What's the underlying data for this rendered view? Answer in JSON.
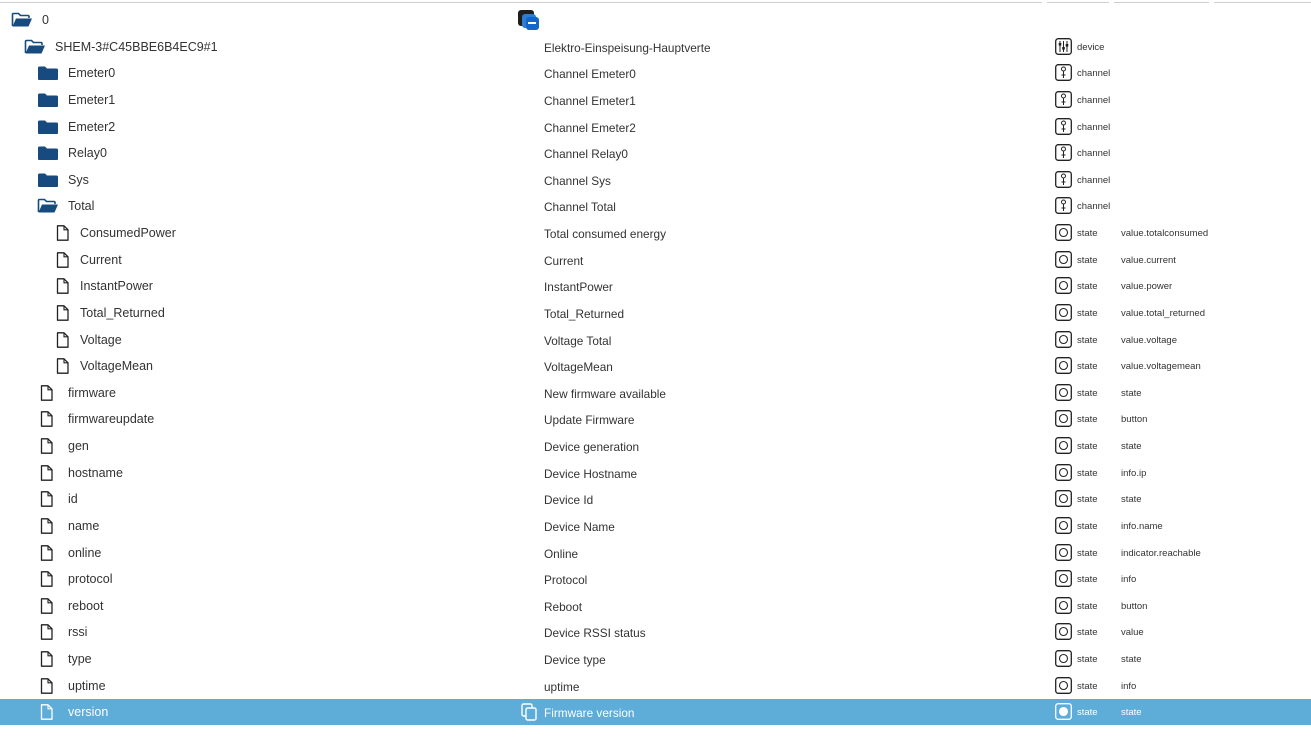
{
  "tree": {
    "rows": [
      {
        "id": "0",
        "name": "",
        "kind": "root",
        "type": "",
        "role": "",
        "indent": 0,
        "icon": "folder-open-icon"
      },
      {
        "id": "SHEM-3#C45BBE6B4EC9#1",
        "name": "Elektro-Einspeisung-Hauptverte",
        "kind": "device",
        "type": "device",
        "role": "",
        "indent": 1,
        "icon": "folder-open-icon"
      },
      {
        "id": "Emeter0",
        "name": "Channel Emeter0",
        "kind": "channel",
        "type": "channel",
        "role": "",
        "indent": 2,
        "icon": "folder-icon"
      },
      {
        "id": "Emeter1",
        "name": "Channel Emeter1",
        "kind": "channel",
        "type": "channel",
        "role": "",
        "indent": 2,
        "icon": "folder-icon"
      },
      {
        "id": "Emeter2",
        "name": "Channel Emeter2",
        "kind": "channel",
        "type": "channel",
        "role": "",
        "indent": 2,
        "icon": "folder-icon"
      },
      {
        "id": "Relay0",
        "name": "Channel Relay0",
        "kind": "channel",
        "type": "channel",
        "role": "",
        "indent": 2,
        "icon": "folder-icon"
      },
      {
        "id": "Sys",
        "name": "Channel Sys",
        "kind": "channel",
        "type": "channel",
        "role": "",
        "indent": 2,
        "icon": "folder-icon"
      },
      {
        "id": "Total",
        "name": "Channel Total",
        "kind": "channel",
        "type": "channel",
        "role": "",
        "indent": 2,
        "icon": "folder-open-icon"
      },
      {
        "id": "ConsumedPower",
        "name": "Total consumed energy",
        "kind": "state",
        "type": "state",
        "role": "value.totalconsumed",
        "indent": 3,
        "icon": "file-icon"
      },
      {
        "id": "Current",
        "name": "Current",
        "kind": "state",
        "type": "state",
        "role": "value.current",
        "indent": 3,
        "icon": "file-icon"
      },
      {
        "id": "InstantPower",
        "name": "InstantPower",
        "kind": "state",
        "type": "state",
        "role": "value.power",
        "indent": 3,
        "icon": "file-icon"
      },
      {
        "id": "Total_Returned",
        "name": "Total_Returned",
        "kind": "state",
        "type": "state",
        "role": "value.total_returned",
        "indent": 3,
        "icon": "file-icon"
      },
      {
        "id": "Voltage",
        "name": "Voltage Total",
        "kind": "state",
        "type": "state",
        "role": "value.voltage",
        "indent": 3,
        "icon": "file-icon"
      },
      {
        "id": "VoltageMean",
        "name": "VoltageMean",
        "kind": "state",
        "type": "state",
        "role": "value.voltagemean",
        "indent": 3,
        "icon": "file-icon"
      },
      {
        "id": "firmware",
        "name": "New firmware available",
        "kind": "state",
        "type": "state",
        "role": "state",
        "indent": 2,
        "icon": "file-icon"
      },
      {
        "id": "firmwareupdate",
        "name": "Update Firmware",
        "kind": "state",
        "type": "state",
        "role": "button",
        "indent": 2,
        "icon": "file-icon"
      },
      {
        "id": "gen",
        "name": "Device generation",
        "kind": "state",
        "type": "state",
        "role": "state",
        "indent": 2,
        "icon": "file-icon"
      },
      {
        "id": "hostname",
        "name": "Device Hostname",
        "kind": "state",
        "type": "state",
        "role": "info.ip",
        "indent": 2,
        "icon": "file-icon"
      },
      {
        "id": "id",
        "name": "Device Id",
        "kind": "state",
        "type": "state",
        "role": "state",
        "indent": 2,
        "icon": "file-icon"
      },
      {
        "id": "name",
        "name": "Device Name",
        "kind": "state",
        "type": "state",
        "role": "info.name",
        "indent": 2,
        "icon": "file-icon"
      },
      {
        "id": "online",
        "name": "Online",
        "kind": "state",
        "type": "state",
        "role": "indicator.reachable",
        "indent": 2,
        "icon": "file-icon"
      },
      {
        "id": "protocol",
        "name": "Protocol",
        "kind": "state",
        "type": "state",
        "role": "info",
        "indent": 2,
        "icon": "file-icon"
      },
      {
        "id": "reboot",
        "name": "Reboot",
        "kind": "state",
        "type": "state",
        "role": "button",
        "indent": 2,
        "icon": "file-icon"
      },
      {
        "id": "rssi",
        "name": "Device RSSI status",
        "kind": "state",
        "type": "state",
        "role": "value",
        "indent": 2,
        "icon": "file-icon"
      },
      {
        "id": "type",
        "name": "Device type",
        "kind": "state",
        "type": "state",
        "role": "state",
        "indent": 2,
        "icon": "file-icon"
      },
      {
        "id": "uptime",
        "name": "uptime",
        "kind": "state",
        "type": "state",
        "role": "info",
        "indent": 2,
        "icon": "file-icon"
      },
      {
        "id": "version",
        "name": "Firmware version",
        "kind": "state",
        "type": "state",
        "role": "state",
        "indent": 2,
        "icon": "file-icon",
        "selected": true
      }
    ]
  },
  "colors": {
    "folder": "#174a7e",
    "selected_row": "#5eacd8",
    "text": "#333333",
    "icon_outline": "#222222"
  }
}
